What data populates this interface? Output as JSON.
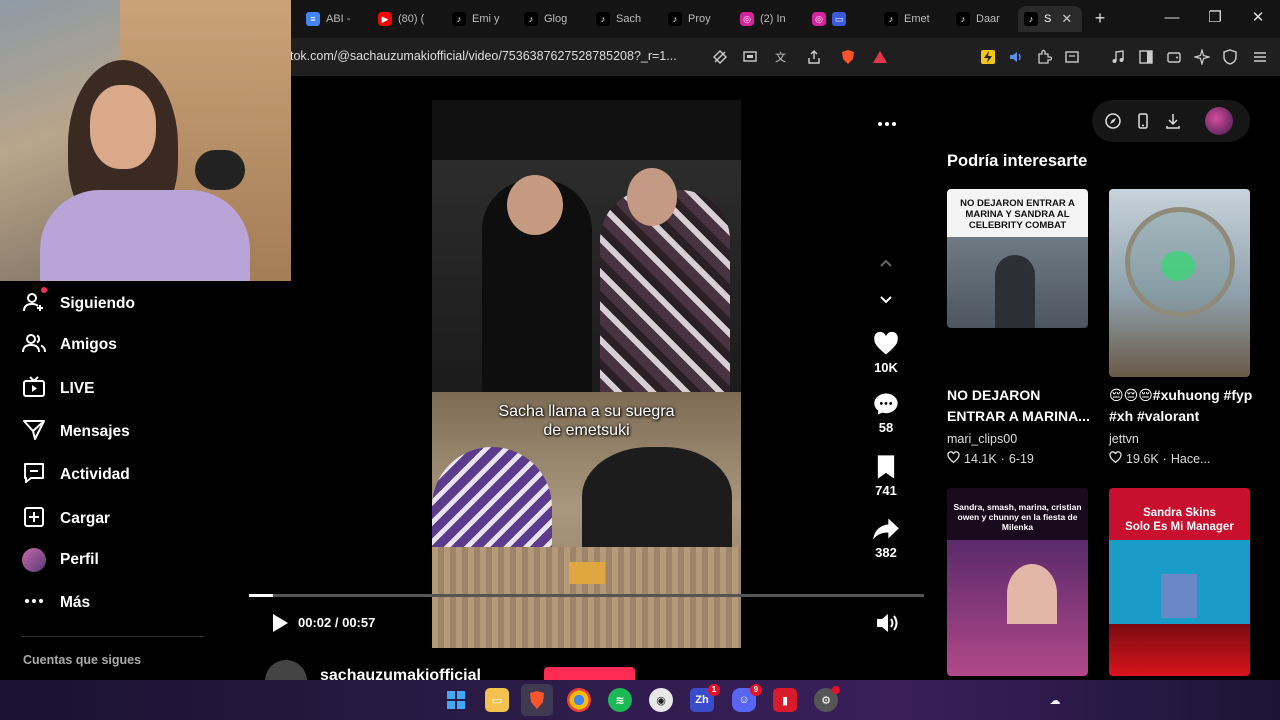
{
  "browser": {
    "tabs": [
      {
        "label": "ABI -",
        "icon": "docs-icon",
        "color": "#4285f4"
      },
      {
        "label": "(80) (",
        "icon": "youtube-icon",
        "color": "#ff0000"
      },
      {
        "label": "Emi y",
        "icon": "tiktok-icon",
        "color": "#000000"
      },
      {
        "label": "Glog",
        "icon": "tiktok-icon",
        "color": "#000000"
      },
      {
        "label": "Sach",
        "icon": "tiktok-icon",
        "color": "#000000"
      },
      {
        "label": "Proy",
        "icon": "tiktok-icon",
        "color": "#000000"
      },
      {
        "label": "(2) In",
        "icon": "instagram-icon",
        "color": "#d6249f"
      },
      {
        "label": "",
        "icon": "instagram-icon",
        "color": "#d6249f"
      },
      {
        "label": "Emet",
        "icon": "tiktok-icon",
        "color": "#000000"
      },
      {
        "label": "Daar",
        "icon": "tiktok-icon",
        "color": "#000000"
      },
      {
        "label": "S",
        "icon": "tiktok-icon",
        "color": "#000000",
        "active": true
      }
    ],
    "url": "tok.com/@sachauzumakiofficial/video/7536387627528785208?_r=1..."
  },
  "sidebar": {
    "items": [
      {
        "label": "Siguiendo",
        "icon": "following-icon"
      },
      {
        "label": "Amigos",
        "icon": "friends-icon"
      },
      {
        "label": "LIVE",
        "icon": "live-icon"
      },
      {
        "label": "Mensajes",
        "icon": "messages-icon"
      },
      {
        "label": "Actividad",
        "icon": "activity-icon"
      },
      {
        "label": "Cargar",
        "icon": "upload-icon"
      },
      {
        "label": "Perfil",
        "icon": "profile-avatar"
      },
      {
        "label": "Más",
        "icon": "more-icon"
      }
    ],
    "following_accounts_label": "Cuentas que sigues"
  },
  "video": {
    "caption_line1": "Sacha llama a su suegra",
    "caption_line2": "de emetsuki",
    "likes": "10K",
    "comments": "58",
    "saves": "741",
    "shares": "382",
    "current_time": "00:02",
    "duration": "00:57",
    "time_display": "00:02 / 00:57",
    "progress": 0.035,
    "author": "sachauzumakiofficial"
  },
  "recommendations": {
    "title": "Podría interesarte",
    "cards": [
      {
        "thumb_text": "NO DEJARON ENTRAR A MARINA Y SANDRA AL CELEBRITY COMBAT",
        "title": "NO DEJARON ENTRAR A MARINA...",
        "user": "mari_clips00",
        "likes": "14.1K",
        "date": "6-19"
      },
      {
        "thumb_text": "",
        "title": "😔😔😔#xuhuong #fyp #xh #valorant",
        "user": "jettvn",
        "likes": "19.6K",
        "date": "Hace..."
      },
      {
        "thumb_text": "Sandra, smash, marina, cristian owen y chunny en la fiesta de Milenka",
        "title": "",
        "user": "",
        "likes": "",
        "date": ""
      },
      {
        "thumb_text_line1": "Sandra Skins",
        "thumb_text_line2": "Solo Es Mi Manager",
        "title": "",
        "user": "",
        "likes": "",
        "date": ""
      }
    ]
  },
  "colors": {
    "accent": "#fe2c55",
    "background": "#000000",
    "taskbar": "#2b1b48"
  }
}
